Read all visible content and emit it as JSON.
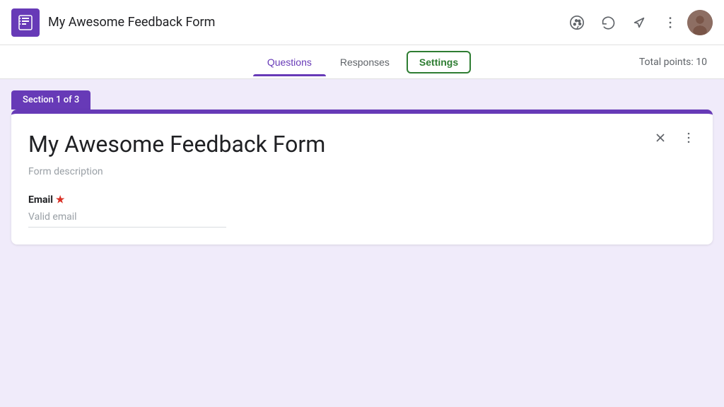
{
  "header": {
    "title": "My Awesome Feedback Form",
    "logo_alt": "Google Forms icon"
  },
  "tabs": {
    "questions_label": "Questions",
    "responses_label": "Responses",
    "settings_label": "Settings",
    "total_points_label": "Total points: 10"
  },
  "section_badge": "Section 1 of 3",
  "form_card": {
    "title": "My Awesome Feedback Form",
    "description": "Form description",
    "email_label": "Email",
    "email_input": "Valid email",
    "collapse_icon_label": "×",
    "more_icon_label": "⋮"
  },
  "icons": {
    "palette": "🎨",
    "undo": "↩",
    "send": "▷",
    "more_vert": "⋮",
    "collapse": "⤫"
  }
}
